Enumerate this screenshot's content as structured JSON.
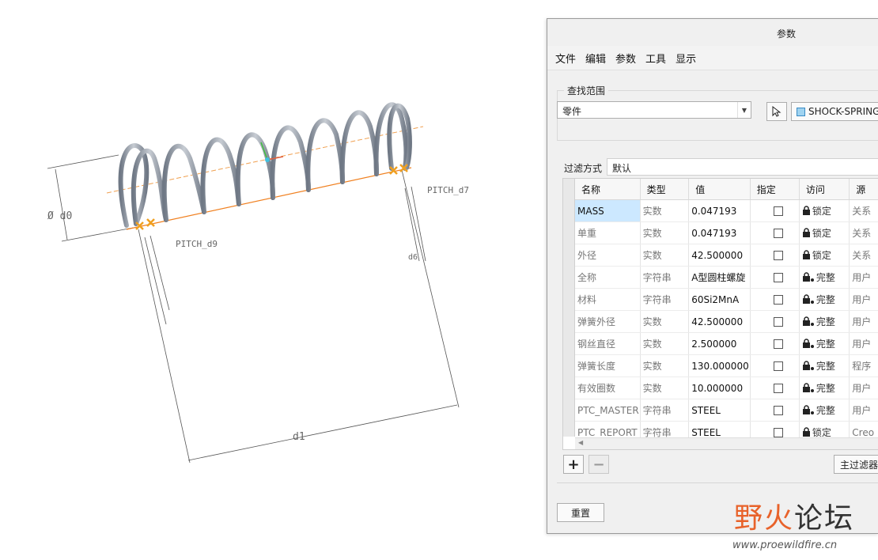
{
  "cad": {
    "dim_d0": "Ø d0",
    "dim_d1": "d1",
    "pitch_left": "PITCH_d9",
    "pitch_right": "PITCH_d7",
    "pitch_small": "d6"
  },
  "dialog": {
    "title": "参数",
    "menu": [
      "文件",
      "编辑",
      "参数",
      "工具",
      "显示"
    ],
    "scope_label": "查找范围",
    "scope_value": "零件",
    "part_name": "SHOCK-SPRING",
    "filter_label": "过滤方式",
    "filter_value": "默认",
    "columns": [
      "名称",
      "类型",
      "值",
      "指定",
      "访问",
      "源"
    ],
    "rows": [
      {
        "name": "MASS",
        "type": "实数",
        "value": "0.047193",
        "access": "锁定",
        "source": "关系"
      },
      {
        "name": "单重",
        "type": "实数",
        "value": "0.047193",
        "access": "锁定",
        "source": "关系"
      },
      {
        "name": "外径",
        "type": "实数",
        "value": "42.500000",
        "access": "锁定",
        "source": "关系"
      },
      {
        "name": "全称",
        "type": "字符串",
        "value": "A型圆柱螺旋",
        "access": "完整",
        "source": "用户"
      },
      {
        "name": "材料",
        "type": "字符串",
        "value": "60Si2MnA",
        "access": "完整",
        "source": "用户"
      },
      {
        "name": "弹簧外径",
        "type": "实数",
        "value": "42.500000",
        "access": "完整",
        "source": "用户"
      },
      {
        "name": "钢丝直径",
        "type": "实数",
        "value": "2.500000",
        "access": "完整",
        "source": "用户"
      },
      {
        "name": "弹簧长度",
        "type": "实数",
        "value": "130.000000",
        "access": "完整",
        "source": "程序"
      },
      {
        "name": "有效圈数",
        "type": "实数",
        "value": "10.000000",
        "access": "完整",
        "source": "用户"
      },
      {
        "name": "PTC_MASTER",
        "type": "字符串",
        "value": "STEEL",
        "access": "完整",
        "source": "用户"
      },
      {
        "name": "PTC_REPORT",
        "type": "字符串",
        "value": "STEEL",
        "access": "锁定",
        "source": "Creo"
      }
    ],
    "add_label": "+",
    "remove_label": "−",
    "main_filter_label": "主过滤器",
    "reset_label": "重置"
  },
  "watermark": {
    "logo_a": "野火",
    "logo_b": "论坛",
    "url": "www.proewildfire.cn"
  }
}
